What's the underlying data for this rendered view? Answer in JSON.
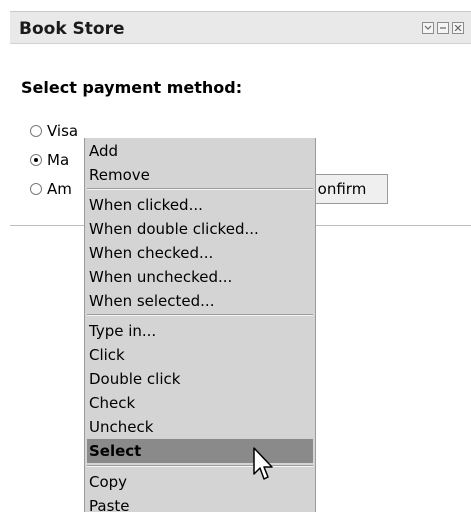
{
  "window": {
    "title": "Book Store",
    "buttons": [
      "minimize",
      "restore",
      "close"
    ]
  },
  "form": {
    "heading": "Select payment method:",
    "options": [
      {
        "label": "Visa",
        "checked": false
      },
      {
        "label": "Ma",
        "checked": true
      },
      {
        "label": "Am",
        "checked": false
      }
    ],
    "confirm_label": "onfirm"
  },
  "context_menu": {
    "group1": [
      "Add",
      "Remove"
    ],
    "group2": [
      "When clicked...",
      "When double clicked...",
      "When checked...",
      "When unchecked...",
      "When selected..."
    ],
    "group3": [
      "Type in...",
      "Click",
      "Double click",
      "Check",
      "Uncheck",
      "Select"
    ],
    "group4": [
      "Copy",
      "Paste"
    ],
    "selected_item": "Select"
  },
  "colors": {
    "menu_bg": "#d4d4d4",
    "menu_highlight": "#8a8a8a",
    "titlebar_bg": "#e9e9e9"
  }
}
